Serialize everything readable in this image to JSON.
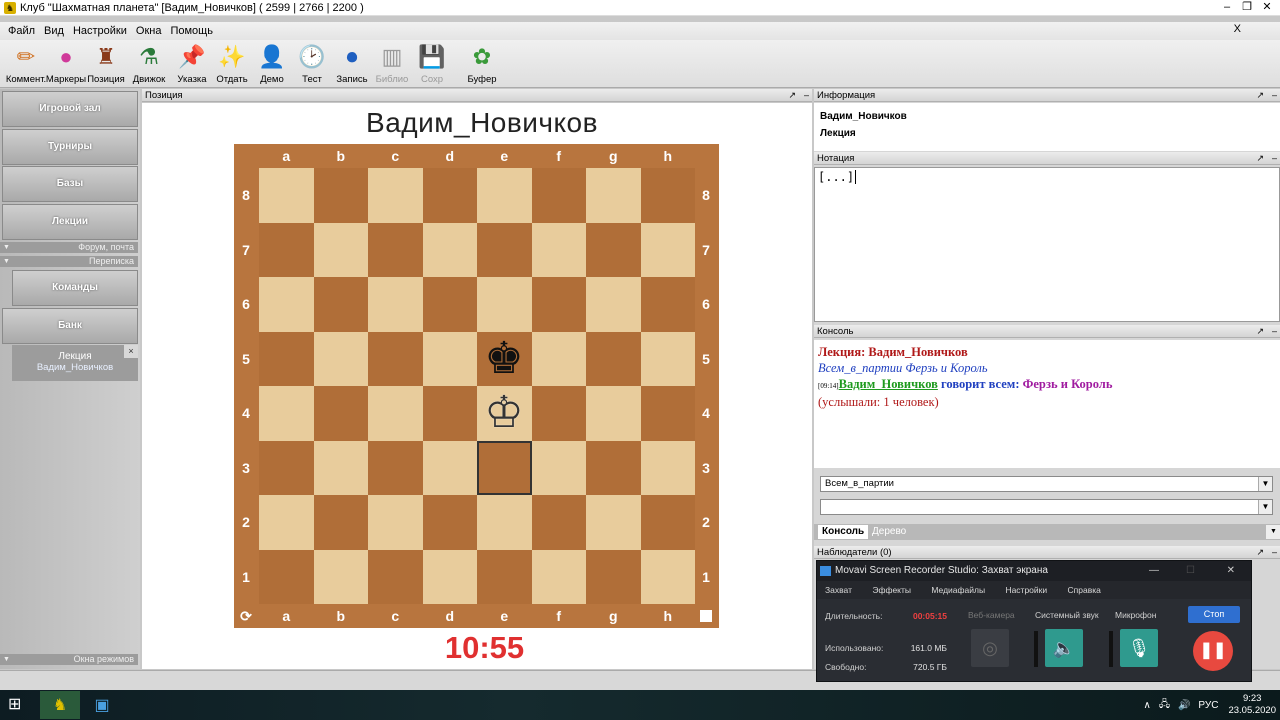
{
  "window": {
    "title": "Клуб \"Шахматная планета\" [Вадим_Новичков]  ( 2599 | 2766 | 2200 )"
  },
  "menu": [
    "Файл",
    "Вид",
    "Настройки",
    "Окна",
    "Помощь"
  ],
  "menu_close": "X",
  "toolbar": [
    {
      "label": "Коммент.",
      "icon": "pencil-icon",
      "glyph": "✏"
    },
    {
      "label": "Маркеры",
      "icon": "markers-icon",
      "glyph": "●"
    },
    {
      "label": "Позиция",
      "icon": "position-icon",
      "glyph": "♜"
    },
    {
      "label": "Движок",
      "icon": "engine-icon",
      "glyph": "⚗"
    },
    {
      "label": "Указка",
      "icon": "pointer-icon",
      "glyph": "📌"
    },
    {
      "label": "Отдать",
      "icon": "wand-icon",
      "glyph": "✨"
    },
    {
      "label": "Демо",
      "icon": "demo-icon",
      "glyph": "👤"
    },
    {
      "label": "Тест",
      "icon": "clock-icon",
      "glyph": "🕑"
    },
    {
      "label": "Запись",
      "icon": "record-icon",
      "glyph": "⏺"
    },
    {
      "label": "Библио",
      "icon": "library-icon",
      "glyph": "▥",
      "disabled": true
    },
    {
      "label": "Сохр",
      "icon": "save-icon",
      "glyph": "💾",
      "disabled": true
    },
    {
      "label": "Буфер",
      "icon": "buffer-icon",
      "glyph": "✿"
    }
  ],
  "sidebar": {
    "buttons": [
      "Игровой зал",
      "Турниры",
      "Базы",
      "Лекции"
    ],
    "strip1": "Форум, почта",
    "strip2": "Переписка",
    "buttons2": [
      "Команды",
      "Банк"
    ],
    "lecture_tab": {
      "title": "Лекция",
      "subtitle": "Вадим_Новичков",
      "close": "×"
    },
    "bottom_strip": "Окна режимов"
  },
  "position_panel": {
    "header": "Позиция",
    "player": "Вадим_Новичков",
    "clock": "10:55"
  },
  "board": {
    "files": [
      "a",
      "b",
      "c",
      "d",
      "e",
      "f",
      "g",
      "h"
    ],
    "ranks": [
      "8",
      "7",
      "6",
      "5",
      "4",
      "3",
      "2",
      "1"
    ],
    "black_king": "e5",
    "white_king": "e4",
    "highlight": "e3",
    "black_king_glyph": "♚",
    "white_king_glyph": "♔"
  },
  "info_panel": {
    "header": "Информация",
    "line1": "Вадим_Новичков",
    "line2": "Лекция"
  },
  "notation_panel": {
    "header": "Нотация",
    "content": "[...]"
  },
  "console_panel": {
    "header": "Консоль",
    "line1": "Лекция: Вадим_Новичков",
    "line2": "Всем_в_партии Ферзь и Король",
    "line3_time": "[09:14]",
    "line3_user": "Вадим_Новичков",
    "line3_mid": " говорит всем: ",
    "line3_msg": "Ферзь и Король",
    "line4": "(услышали: 1 человек)",
    "recipient_select": "Всем_в_партии",
    "message_input": "",
    "tabs": [
      "Консоль",
      "Дерево"
    ]
  },
  "observers_panel": {
    "header": "Наблюдатели (0)"
  },
  "movavi": {
    "title": "Movavi Screen Recorder Studio: Захват экрана",
    "menu": [
      "Захват",
      "Эффекты",
      "Медиафайлы",
      "Настройки",
      "Справка"
    ],
    "duration_label": "Длительность:",
    "duration": "00:05:15",
    "used_label": "Использовано:",
    "used": "161.0 МБ",
    "free_label": "Свободно:",
    "free": "720.5 ГБ",
    "webcam_label": "Веб-камера",
    "sys_sound_label": "Системный звук",
    "mic_label": "Микрофон",
    "stop_label": "Стоп"
  },
  "taskbar": {
    "lang": "РУС",
    "time": "9:23",
    "date": "23.05.2020"
  }
}
